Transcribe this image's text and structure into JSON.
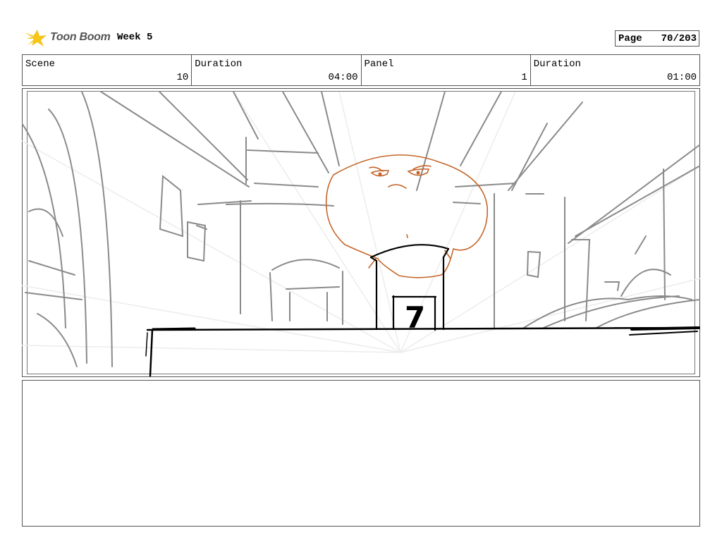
{
  "header": {
    "brand": "Toon Boom",
    "logo_icon": "toon-boom-star-logo",
    "title": "Week 5",
    "page_label": "Page",
    "page_value": "70/203"
  },
  "info": {
    "scene_label": "Scene",
    "scene_value": "10",
    "duration_label": "Duration",
    "duration_value": "04:00",
    "panel_label": "Panel",
    "panel_value": "1",
    "panel_duration_label": "Duration",
    "panel_duration_value": "01:00"
  },
  "panel": {
    "sign_text": "7",
    "colors": {
      "character": "#c4662a",
      "lines": "#888888",
      "ink": "#000000"
    }
  },
  "notes": {
    "text": ""
  },
  "colors": {
    "logo_yellow": "#f5c518",
    "border": "#555555"
  }
}
